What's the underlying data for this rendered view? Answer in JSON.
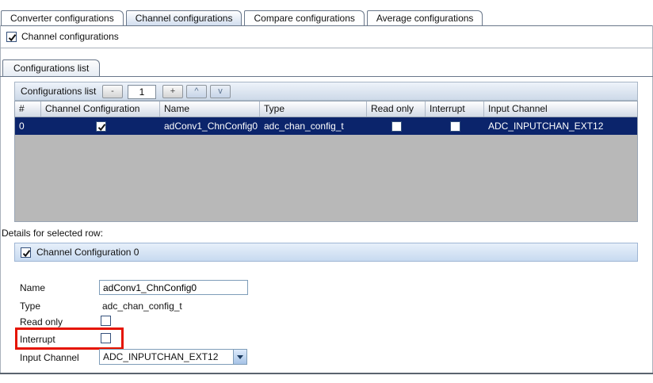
{
  "colors": {
    "selection": "#0b246b",
    "highlight": "#e51400"
  },
  "tabs": [
    {
      "label": "Converter configurations",
      "active": false
    },
    {
      "label": "Channel configurations",
      "active": true
    },
    {
      "label": "Compare configurations",
      "active": false
    },
    {
      "label": "Average configurations",
      "active": false
    }
  ],
  "channel_checkbox": {
    "label": "Channel configurations",
    "checked": true
  },
  "configurations_tab": {
    "label": "Configurations list"
  },
  "list_toolbar": {
    "title": "Configurations list",
    "remove_button": "-",
    "count_value": "1",
    "add_button": "+",
    "up_button": "^",
    "down_button": "v"
  },
  "table": {
    "columns": [
      "#",
      "Channel Configuration",
      "Name",
      "Type",
      "Read only",
      "Interrupt",
      "Input Channel"
    ],
    "rows": [
      {
        "index": "0",
        "channel_configuration_checked": true,
        "name": "adConv1_ChnConfig0",
        "type": "adc_chan_config_t",
        "read_only_checked": false,
        "interrupt_checked": false,
        "input_channel": "ADC_INPUTCHAN_EXT12",
        "selected": true
      }
    ]
  },
  "details": {
    "caption": "Details for selected row:",
    "header": {
      "label": "Channel Configuration 0",
      "checked": true
    },
    "name": {
      "label": "Name",
      "value": "adConv1_ChnConfig0"
    },
    "type": {
      "label": "Type",
      "value": "adc_chan_config_t"
    },
    "read_only": {
      "label": "Read only",
      "checked": false
    },
    "interrupt": {
      "label": "Interrupt",
      "checked": false,
      "highlighted": true
    },
    "input_channel": {
      "label": "Input Channel",
      "value": "ADC_INPUTCHAN_EXT12"
    }
  }
}
